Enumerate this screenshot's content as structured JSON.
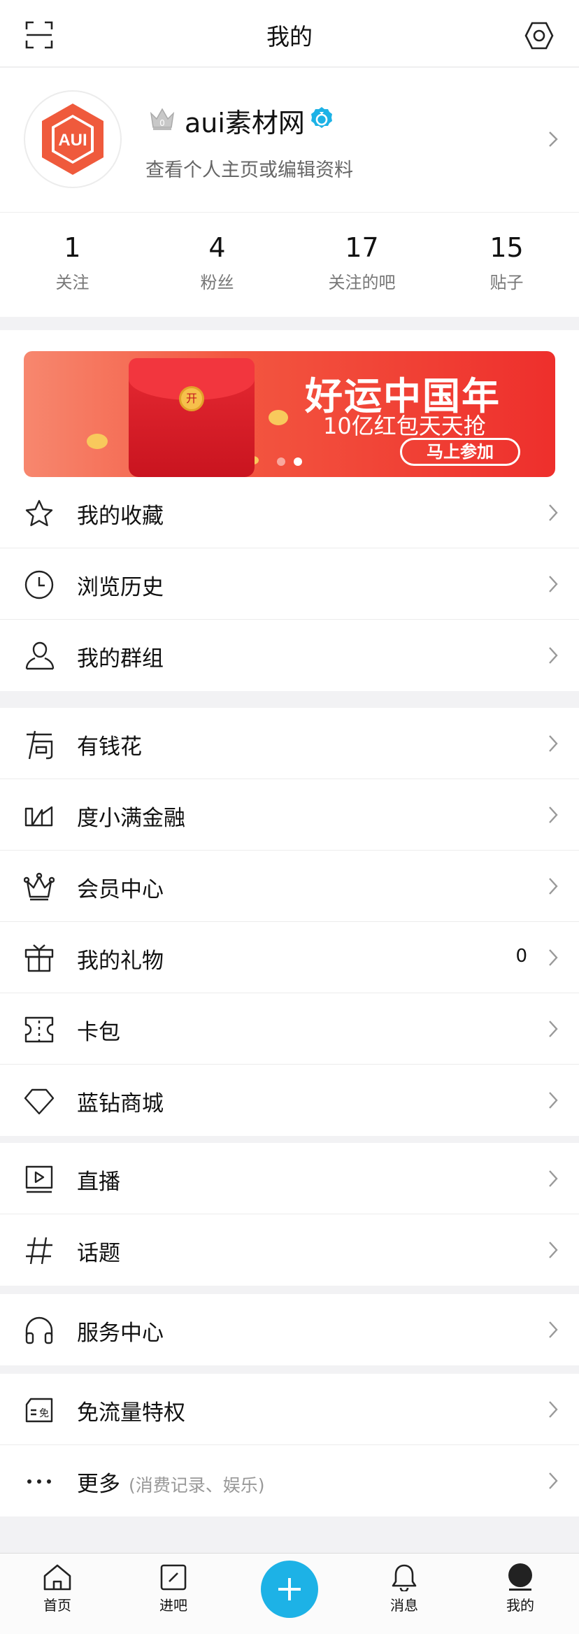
{
  "header": {
    "title": "我的"
  },
  "profile": {
    "avatar_text": "AUI",
    "username": "aui素材网",
    "subtitle": "查看个人主页或编辑资料"
  },
  "stats": [
    {
      "value": "1",
      "label": "关注"
    },
    {
      "value": "4",
      "label": "粉丝"
    },
    {
      "value": "17",
      "label": "关注的吧"
    },
    {
      "value": "15",
      "label": "贴子"
    }
  ],
  "banner": {
    "coin_text": "开",
    "title": "好运中国年",
    "subtitle": "10亿红包天天抢",
    "button": "马上参加",
    "active_slide": 2,
    "slide_count": 2
  },
  "menu": {
    "favorites": "我的收藏",
    "history": "浏览历史",
    "groups": "我的群组",
    "youqianhua": "有钱花",
    "duxiaoman": "度小满金融",
    "vip": "会员中心",
    "gifts": "我的礼物",
    "gifts_count": "0",
    "cards": "卡包",
    "diamond_mall": "蓝钻商城",
    "live": "直播",
    "topics": "话题",
    "service": "服务中心",
    "free_data": "免流量特权",
    "more": "更多",
    "more_hint": "(消费记录、娱乐)"
  },
  "tabbar": {
    "home": "首页",
    "enter_bar": "进吧",
    "messages": "消息",
    "mine": "我的",
    "active": "我的"
  },
  "colors": {
    "accent": "#1db2e6",
    "banner_red": "#ee2f2c",
    "logo_orange": "#ef5a3c"
  }
}
